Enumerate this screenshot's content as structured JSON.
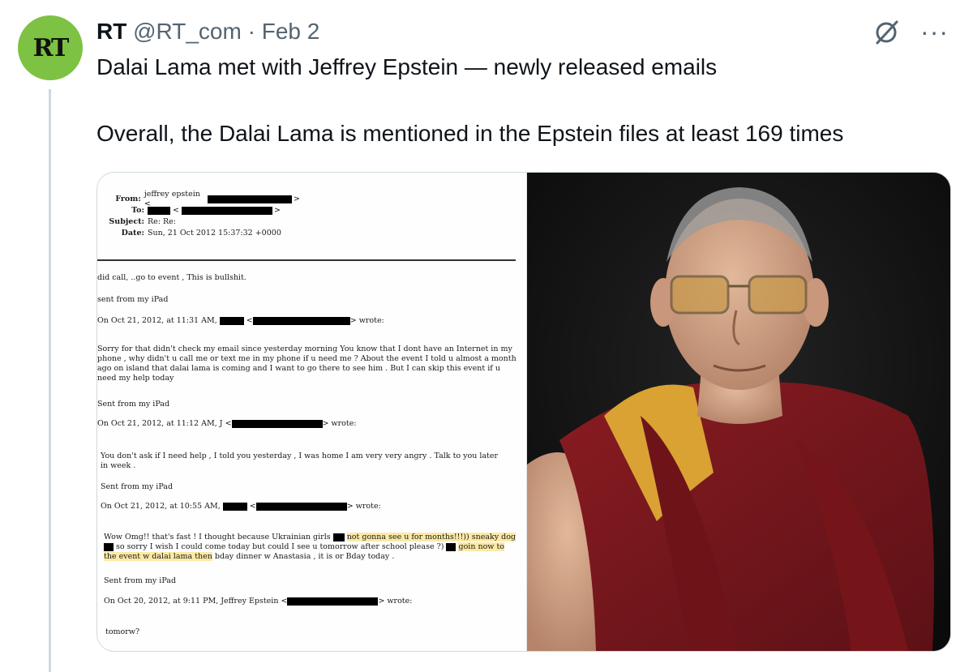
{
  "tweet": {
    "avatar_text": "RT",
    "author_name": "RT",
    "handle": "@RT_com",
    "separator": "·",
    "date": "Feb 2",
    "more_label": "···",
    "text_line1": "Dalai Lama met with Jeffrey Epstein — newly released emails",
    "text_line2": "Overall, the Dalai Lama is mentioned in the Epstein files at least 169 times"
  },
  "email_doc": {
    "from_label": "From:",
    "from_value": "jeffrey epstein <",
    "to_label": "To:",
    "subject_label": "Subject:",
    "subject_value": "Re: Re:",
    "date_label": "Date:",
    "date_value": "Sun, 21 Oct 2012 15:37:32 +0000",
    "l1": "did call, ..go to event ,  This is bullshit.",
    "l2": "sent from my iPad",
    "l3": "On Oct 21, 2012, at 11:31 AM,",
    "wrote": "> wrote:",
    "p1": "Sorry for that  didn't check my email since yesterday morning You know that I dont have an Internet in my phone  , why didn't u call me or text me in my phone if u need me  ? About the event I told u almost a month ago on island that dalai lama is coming and I want to go there to see him . But I can skip this event if u need my help today",
    "l4": "Sent from my iPad",
    "l5": "On Oct 21, 2012, at 11:12 AM, J <",
    "p2": "You don't ask if I need help , I told you yesterday ,    I was home I am very very angry . Talk to you later in week .",
    "l6": "Sent from my iPad",
    "l7": "On Oct 21, 2012, at 10:55 AM,",
    "p3a": "Wow Omg!! that's fast ! I thought because Ukrainian girls",
    "p3b": "not gonna see u for months!!!)) sneaky dog",
    "p3c": "so sorry I wish I could come today but could I see u tomorrow after school please ?)",
    "p3d": "goin now to the event w dalai lama then",
    "p3e": "bday dinner w Anastasia  , it is or Bday today .",
    "l8": "Sent from my iPad",
    "l9": "On Oct 20, 2012, at 9:11 PM, Jeffrey Epstein <",
    "l10": "tomorw?"
  },
  "colors": {
    "avatar_bg": "#7dc242",
    "highlight": "#fbe9a6",
    "secondary_text": "#536471"
  }
}
